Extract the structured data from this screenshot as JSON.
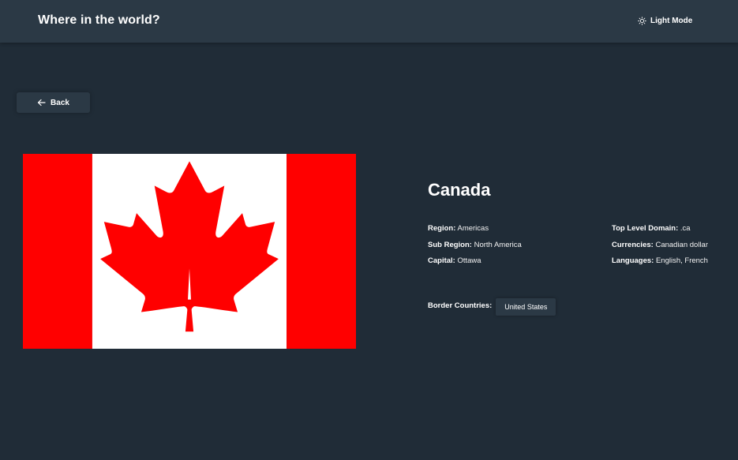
{
  "header": {
    "title": "Where in the world?",
    "mode_toggle_label": "Light Mode",
    "mode_icon": "sun-icon"
  },
  "back": {
    "label": "Back",
    "icon": "arrow-left-icon"
  },
  "country": {
    "name": "Canada",
    "flag": {
      "icon": "canada-flag",
      "colors": {
        "red": "#ff0000",
        "white": "#ffffff"
      }
    },
    "left_info": [
      {
        "label": "Region:",
        "value": "Americas"
      },
      {
        "label": "Sub Region:",
        "value": "North America"
      },
      {
        "label": "Capital:",
        "value": "Ottawa"
      }
    ],
    "right_info": [
      {
        "label": "Top Level Domain:",
        "value": ".ca"
      },
      {
        "label": "Currencies:",
        "value": "Canadian dollar"
      },
      {
        "label": "Languages:",
        "value": "English, French"
      }
    ],
    "border_label": "Border Countries:",
    "borders": [
      "United States"
    ]
  },
  "colors": {
    "background": "#202c37",
    "element": "#2b3945",
    "text": "#ffffff"
  }
}
